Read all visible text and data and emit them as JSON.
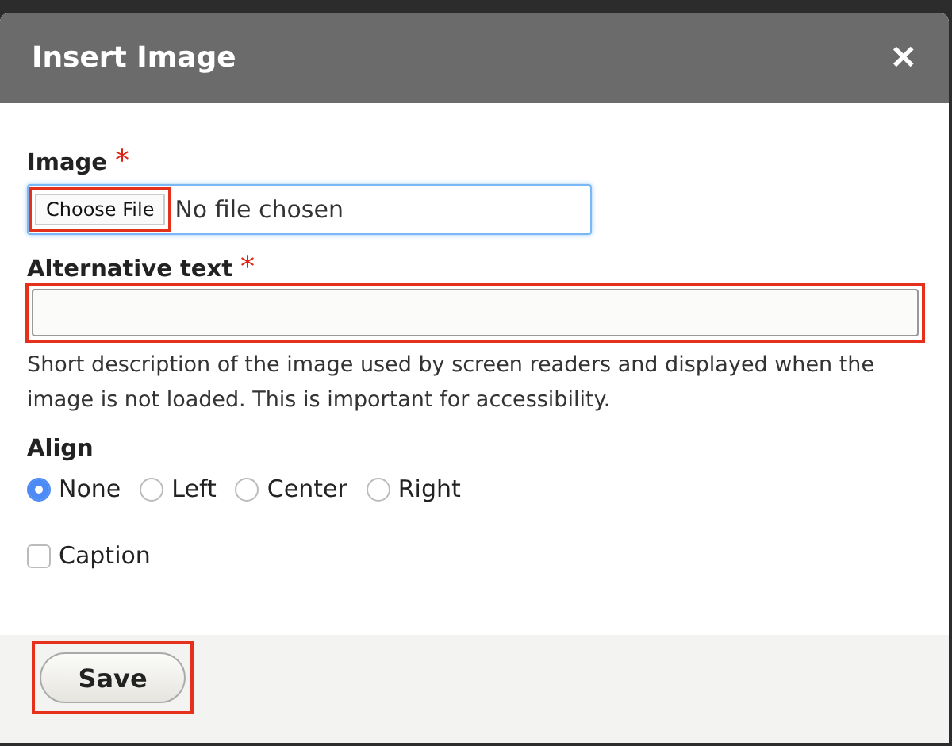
{
  "dialog": {
    "title": "Insert Image",
    "close": "✕"
  },
  "image_field": {
    "label": "Image",
    "required": "*",
    "button": "Choose File",
    "value": "No file chosen",
    "highlighted": true
  },
  "alt_field": {
    "label": "Alternative text",
    "required": "*",
    "highlighted": true,
    "description": "Short description of the image used by screen readers and displayed when the image is not loaded. This is important for accessibility."
  },
  "align": {
    "label": "Align",
    "options": [
      {
        "label": "None",
        "selected": true
      },
      {
        "label": "Left",
        "selected": false
      },
      {
        "label": "Center",
        "selected": false
      },
      {
        "label": "Right",
        "selected": false
      }
    ]
  },
  "caption": {
    "label": "Caption",
    "checked": false
  },
  "save_button": {
    "label": "Save",
    "highlighted": true
  }
}
